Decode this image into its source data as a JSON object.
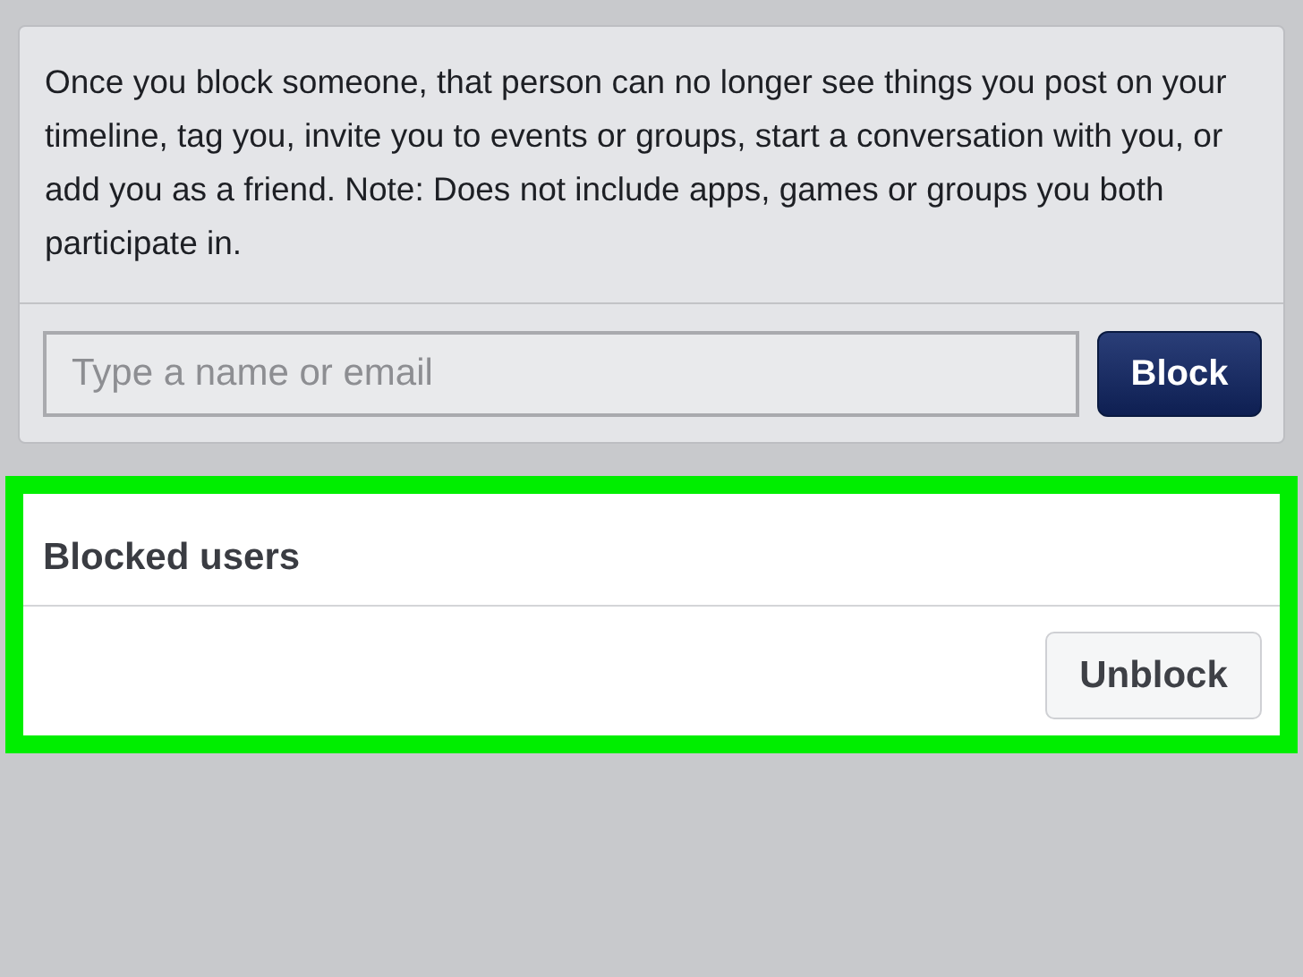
{
  "block_panel": {
    "description": "Once you block someone, that person can no longer see things you post on your timeline, tag you, invite you to events or groups, start a conversation with you, or add you as a friend. Note: Does not include apps, games or groups you both participate in.",
    "search": {
      "placeholder": "Type a name or email"
    },
    "button": "Block"
  },
  "blocked_users": {
    "highlighted": true,
    "title": "Blocked users",
    "rows": [
      {
        "button": "Unblock"
      }
    ]
  }
}
